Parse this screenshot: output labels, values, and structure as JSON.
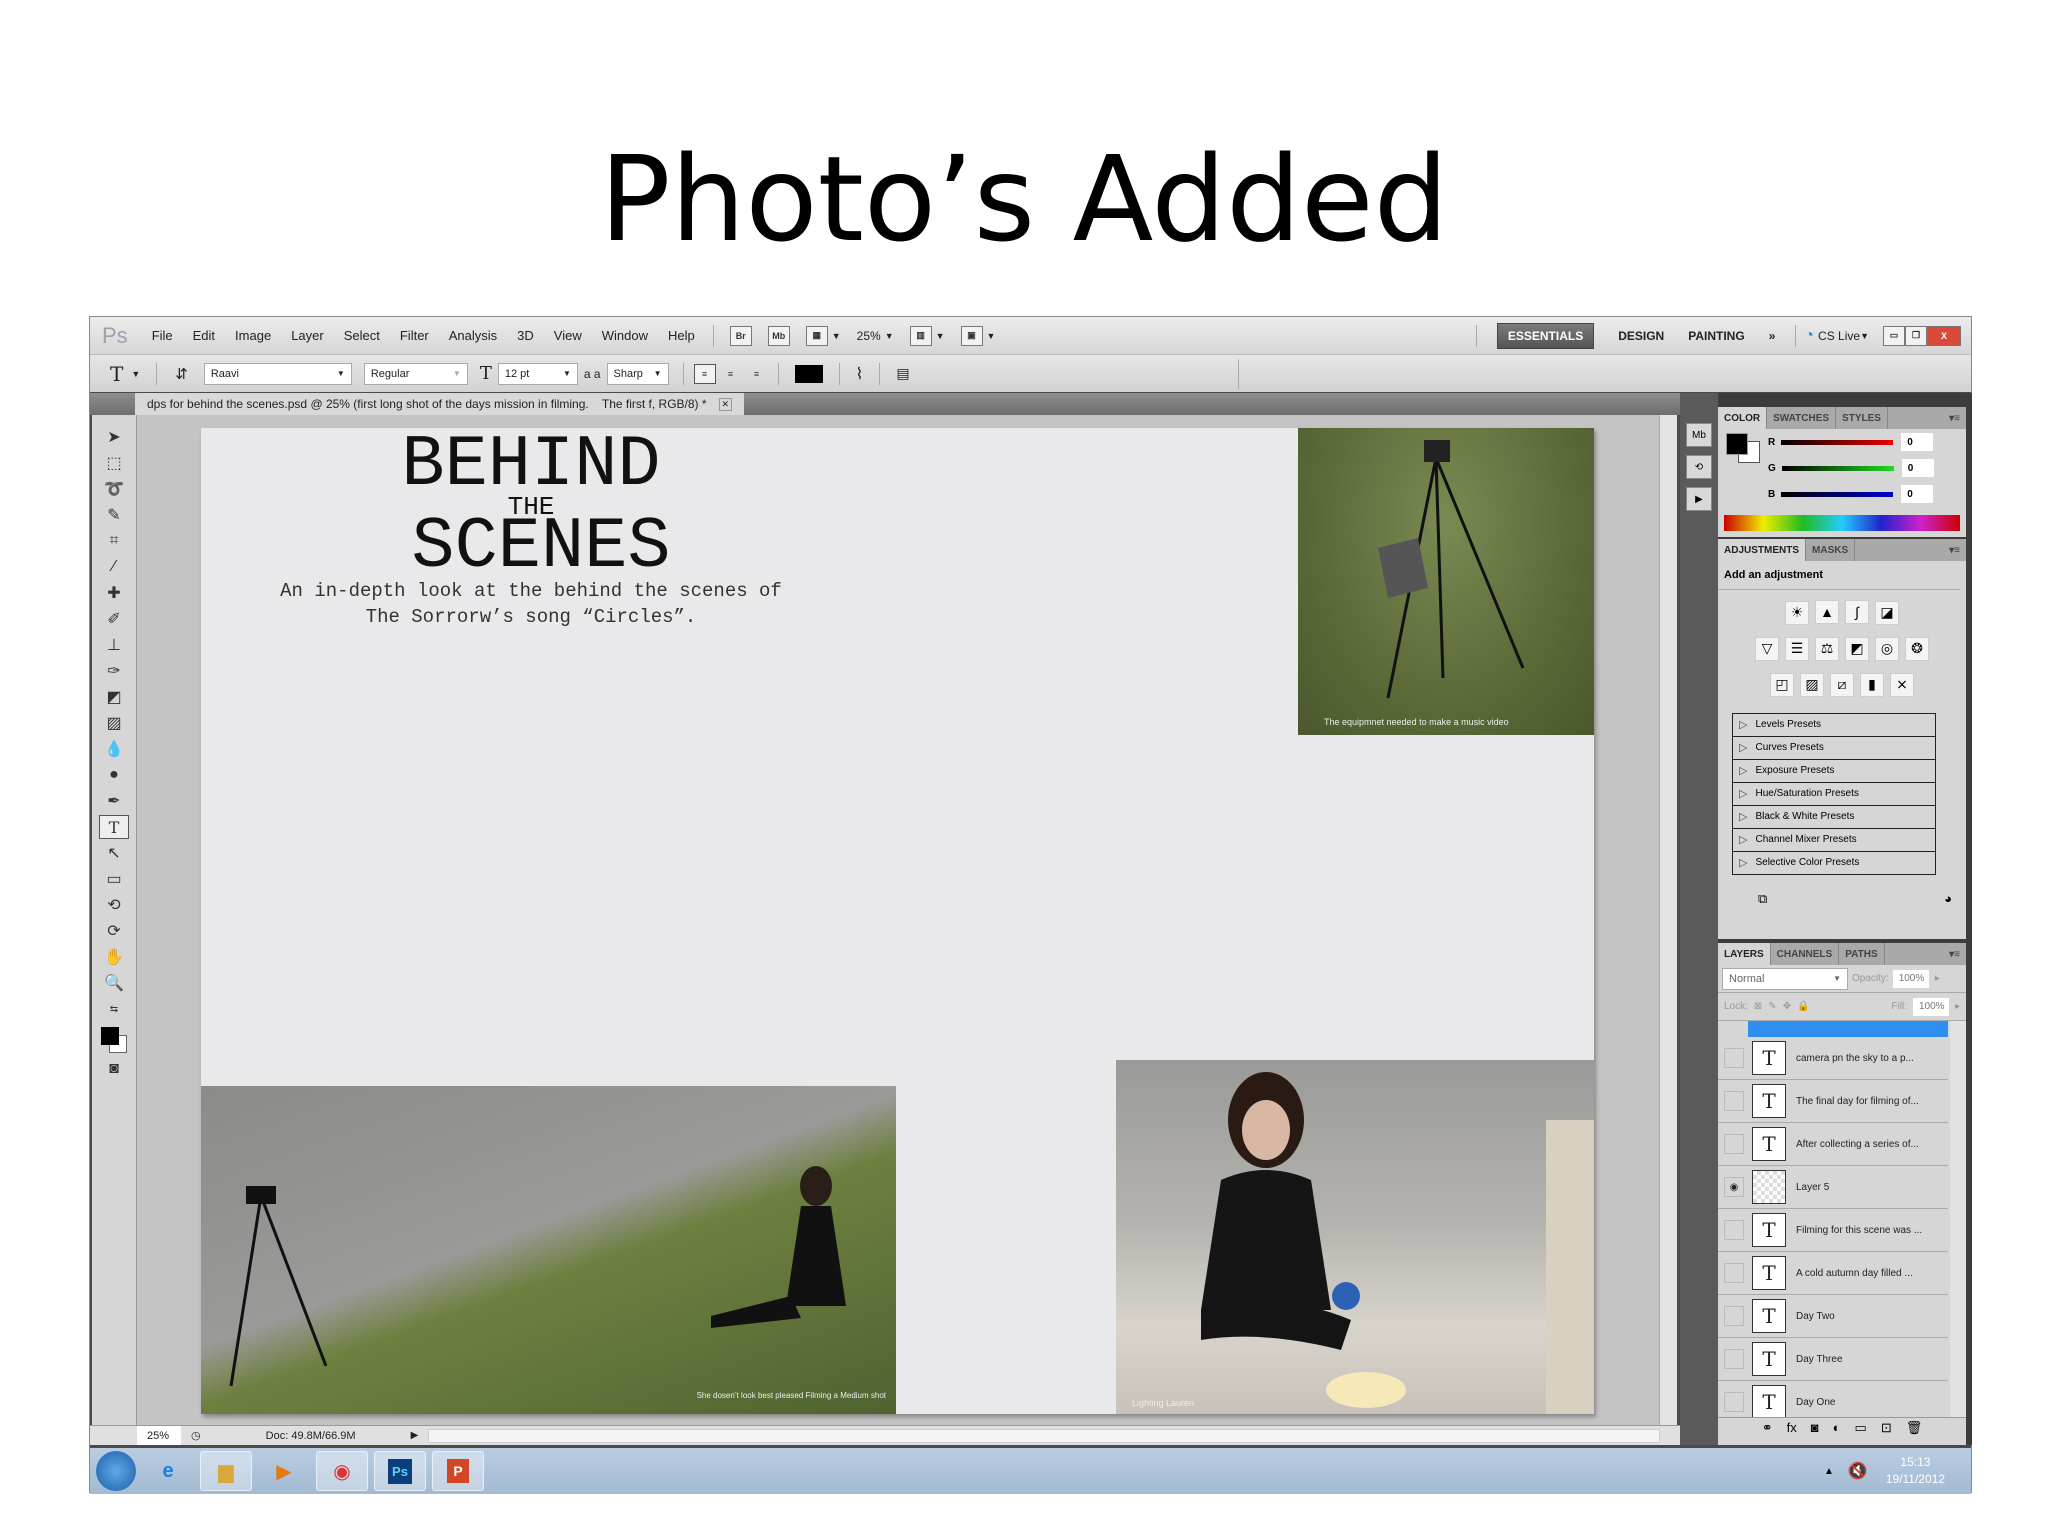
{
  "slide": {
    "title": "Photo’s Added"
  },
  "menubar": {
    "logo": "Ps",
    "items": [
      "File",
      "Edit",
      "Image",
      "Layer",
      "Select",
      "Filter",
      "Analysis",
      "3D",
      "View",
      "Window",
      "Help"
    ],
    "bridge": "Br",
    "minibridge": "Mb",
    "zoom": "25%",
    "workspaces": [
      "ESSENTIALS",
      "DESIGN",
      "PAINTING"
    ],
    "more": "»",
    "cslive": "CS Live"
  },
  "options": {
    "font_family": "Raavi",
    "font_style": "Regular",
    "font_size": "12 pt",
    "aa_label": "a a",
    "antialias": "Sharp",
    "color": "#000000"
  },
  "document": {
    "tab_title": "dps for behind the scenes.psd @ 25% (first long shot of the days mission in filming.    The first f, RGB/8) *",
    "heading_1": "BEHIND",
    "heading_2": "THE",
    "heading_3": "SCENES",
    "subtitle_1": "An in-depth look at the behind the scenes of",
    "subtitle_2": "The Sorrorw’s song “Circles”.",
    "captions": [
      "The equipmnet needed to make a music video",
      "She dosen’t look best pleased  Filming a Medium shot",
      "Lighting Lauren"
    ]
  },
  "status": {
    "zoom": "25%",
    "doc": "Doc: 49.8M/66.9M"
  },
  "color_panel": {
    "tabs": [
      "COLOR",
      "SWATCHES",
      "STYLES"
    ],
    "channels": [
      {
        "label": "R",
        "value": "0"
      },
      {
        "label": "G",
        "value": "0"
      },
      {
        "label": "B",
        "value": "0"
      }
    ]
  },
  "adjustments_panel": {
    "tabs": [
      "ADJUSTMENTS",
      "MASKS"
    ],
    "heading": "Add an adjustment",
    "presets": [
      "Levels Presets",
      "Curves Presets",
      "Exposure Presets",
      "Hue/Saturation Presets",
      "Black & White Presets",
      "Channel Mixer Presets",
      "Selective Color Presets"
    ]
  },
  "layers_panel": {
    "tabs": [
      "LAYERS",
      "CHANNELS",
      "PATHS"
    ],
    "blend_mode": "Normal",
    "opacity_label": "Opacity:",
    "opacity": "100%",
    "lock_label": "Lock:",
    "fill_label": "Fill:",
    "fill": "100%",
    "layers": [
      {
        "name": "camera pn the sky to a  p...",
        "type": "text",
        "visible": false
      },
      {
        "name": "The final day for filming of...",
        "type": "text",
        "visible": false
      },
      {
        "name": "After collecting a  series of...",
        "type": "text",
        "visible": false
      },
      {
        "name": "Layer 5",
        "type": "image",
        "visible": true
      },
      {
        "name": "Filming for this scene was ...",
        "type": "text",
        "visible": false
      },
      {
        "name": "A cold autumn day filled ...",
        "type": "text",
        "visible": false
      },
      {
        "name": "Day Two",
        "type": "text",
        "visible": false
      },
      {
        "name": "Day Three",
        "type": "text",
        "visible": false
      },
      {
        "name": "Day One",
        "type": "text",
        "visible": false
      }
    ]
  },
  "taskbar": {
    "time": "15:13",
    "date": "19/11/2012",
    "apps": [
      "start",
      "internet-explorer",
      "file-explorer",
      "media-player",
      "chrome",
      "photoshop",
      "powerpoint"
    ]
  }
}
